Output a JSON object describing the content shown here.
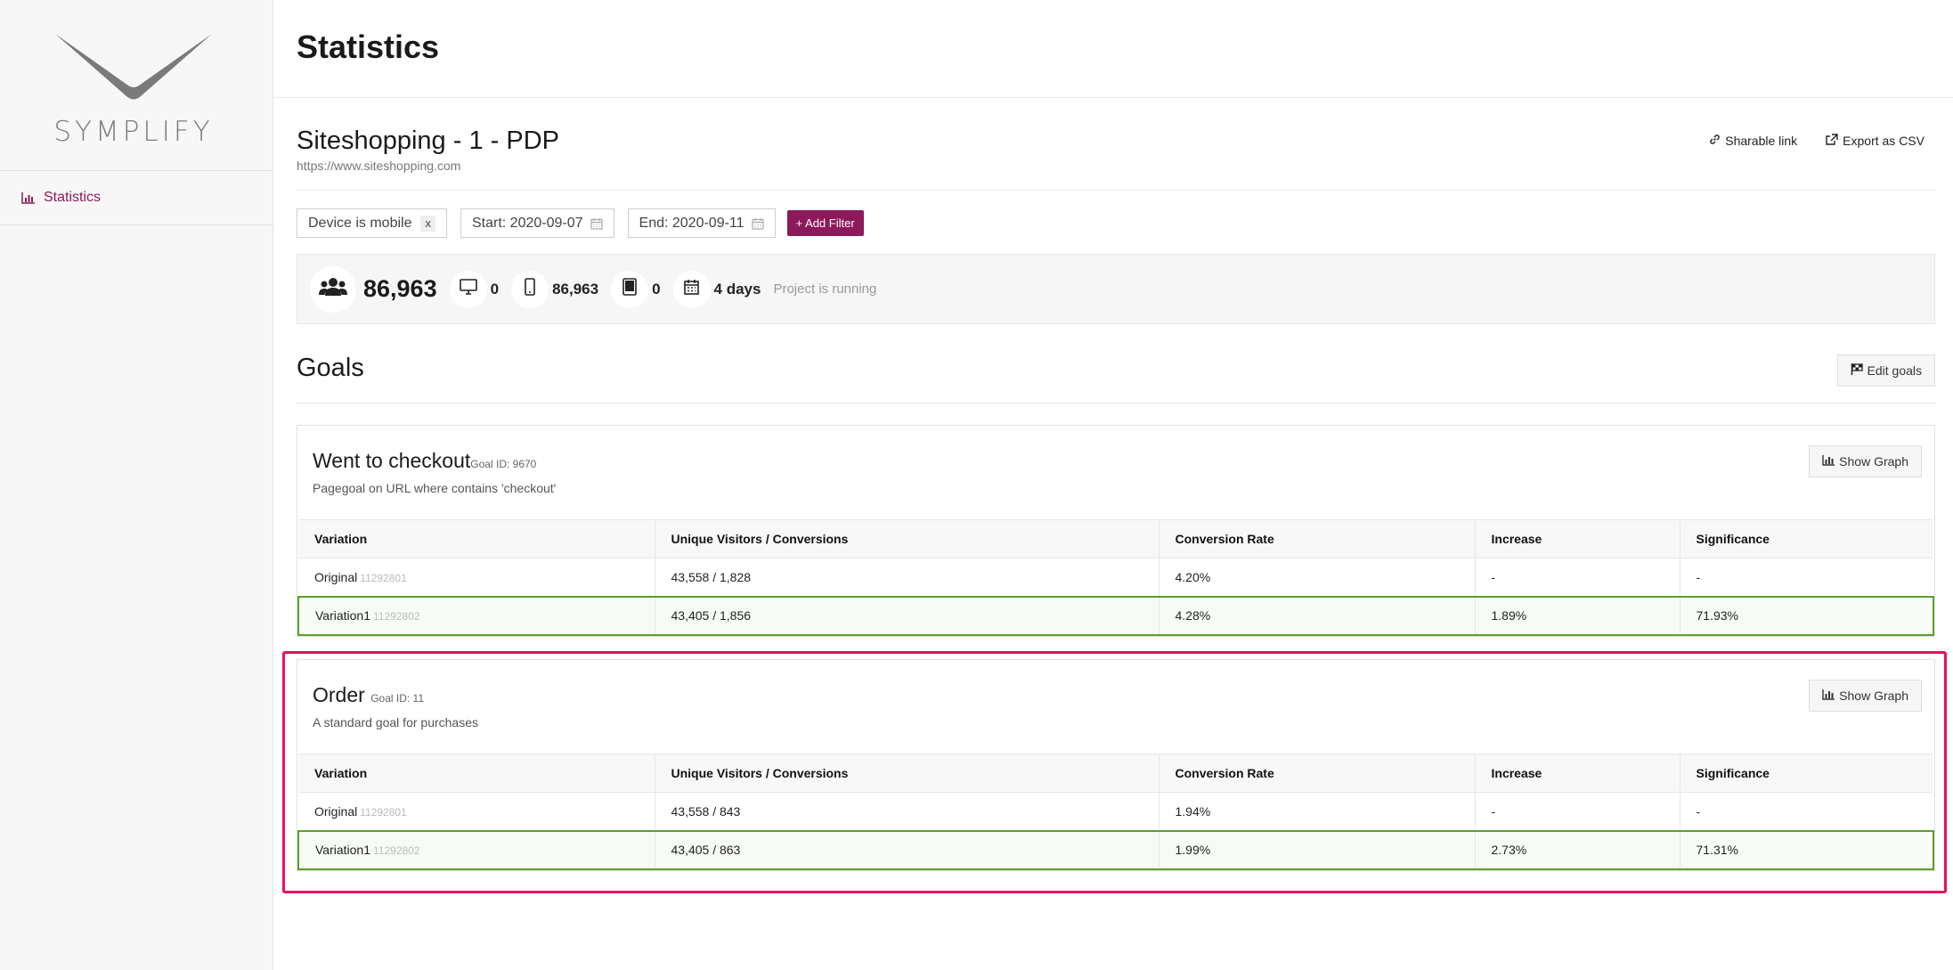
{
  "brand": {
    "name": "SYMPLIFY",
    "accent": "#8c1a5a"
  },
  "sidebar": {
    "items": [
      {
        "label": "Statistics",
        "icon": "bar-chart-icon"
      }
    ]
  },
  "header": {
    "title": "Statistics"
  },
  "project": {
    "title": "Siteshopping - 1 - PDP",
    "url": "https://www.siteshopping.com",
    "actions": {
      "share": "Sharable link",
      "export": "Export as CSV"
    }
  },
  "filters": {
    "device": "Device is mobile",
    "remove": "x",
    "start": "Start: 2020-09-07",
    "end": "End: 2020-09-11",
    "add": "+ Add Filter"
  },
  "stats": {
    "total": "86,963",
    "desktop": "0",
    "mobile": "86,963",
    "tablet": "0",
    "days": "4 days",
    "status": "Project is running"
  },
  "goals": {
    "title": "Goals",
    "edit": "Edit goals",
    "show_graph": "Show Graph",
    "columns": [
      "Variation",
      "Unique Visitors / Conversions",
      "Conversion Rate",
      "Increase",
      "Significance"
    ],
    "items": [
      {
        "name": "Went to checkout",
        "goal_id": "Goal ID: 9670",
        "desc": "Pagegoal on URL where contains 'checkout'",
        "rows": [
          {
            "variation": "Original",
            "vid": "11292801",
            "uv": "43,558 / 1,828",
            "cr": "4.20%",
            "inc": "-",
            "sig": "-"
          },
          {
            "variation": "Variation1",
            "vid": "11292802",
            "uv": "43,405 / 1,856",
            "cr": "4.28%",
            "inc": "1.89%",
            "sig": "71.93%"
          }
        ]
      },
      {
        "name": "Order",
        "goal_id": "Goal ID: 11",
        "desc": "A standard goal for purchases",
        "rows": [
          {
            "variation": "Original",
            "vid": "11292801",
            "uv": "43,558 / 843",
            "cr": "1.94%",
            "inc": "-",
            "sig": "-"
          },
          {
            "variation": "Variation1",
            "vid": "11292802",
            "uv": "43,405 / 863",
            "cr": "1.99%",
            "inc": "2.73%",
            "sig": "71.31%"
          }
        ]
      }
    ]
  }
}
